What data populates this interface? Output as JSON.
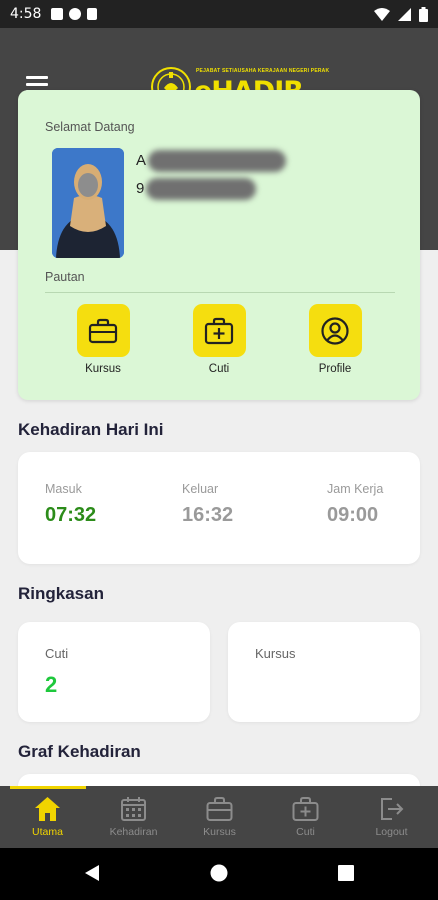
{
  "status_bar": {
    "time": "4:58"
  },
  "app": {
    "logo_subtitle": "PEJABAT SETIAUSAHA KERAJAAN NEGERI PERAK",
    "logo_name": "eHADIR",
    "accent_color": "#f0d400"
  },
  "welcome": {
    "greeting": "Selamat Datang",
    "name_visible": "A",
    "id_visible": "9",
    "links_label": "Pautan",
    "links": [
      {
        "label": "Kursus",
        "icon": "briefcase-icon"
      },
      {
        "label": "Cuti",
        "icon": "medical-bag-icon"
      },
      {
        "label": "Profile",
        "icon": "user-circle-icon"
      }
    ]
  },
  "today": {
    "title": "Kehadiran Hari Ini",
    "items": [
      {
        "label": "Masuk",
        "value": "07:32"
      },
      {
        "label": "Keluar",
        "value": "16:32"
      },
      {
        "label": "Jam Kerja",
        "value": "09:00"
      }
    ]
  },
  "summary": {
    "title": "Ringkasan",
    "cards": [
      {
        "label": "Cuti",
        "value": "2"
      },
      {
        "label": "Kursus",
        "value": ""
      }
    ]
  },
  "graph": {
    "title": "Graf Kehadiran"
  },
  "bottom_nav": {
    "items": [
      {
        "label": "Utama",
        "icon": "home-icon",
        "active": true
      },
      {
        "label": "Kehadiran",
        "icon": "calendar-icon",
        "active": false
      },
      {
        "label": "Kursus",
        "icon": "briefcase-icon",
        "active": false
      },
      {
        "label": "Cuti",
        "icon": "medical-bag-icon",
        "active": false
      },
      {
        "label": "Logout",
        "icon": "logout-icon",
        "active": false
      }
    ]
  }
}
